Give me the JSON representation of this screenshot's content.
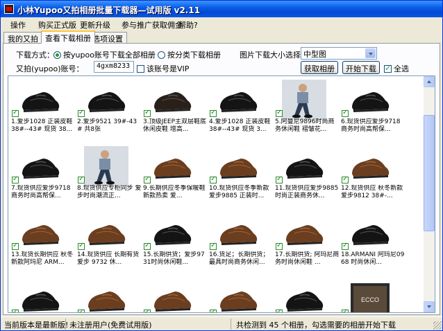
{
  "window": {
    "title": "小林Yupoo又拍相册批量下载器—试用版  v2.11"
  },
  "menu": [
    "操作",
    "购买正式版",
    "更新升级",
    "参与推广获取佣金",
    "帮助?"
  ],
  "tabs": [
    "我的又拍",
    "查看下载相册",
    "选项设置"
  ],
  "download_mode": {
    "label": "下载方式：",
    "option_all": "按yupoo账号下载全部相册",
    "option_category": "按分类下载相册"
  },
  "image_size": {
    "label": "图片下载大小选择：",
    "value": "中型图"
  },
  "account": {
    "label": "又拍(yupoo)账号：",
    "value": "4gxm8233",
    "vip_label": "该账号是VIP"
  },
  "buttons": {
    "fetch": "获取相册",
    "start": "开始下载",
    "select_all": "全选"
  },
  "albums": [
    {
      "caption": "1.爱步1028 正装皮鞋38#--43# 现货 38...",
      "thumb": "shoe-black"
    },
    {
      "caption": "2.爱步9521 39#-43# 共8张",
      "thumb": "shoe-black"
    },
    {
      "caption": "3.顶级JEEP主双层鞋底休闲皮鞋 增高...",
      "thumb": "shoe-dark"
    },
    {
      "caption": "4.爱步1028 正装皮鞋38#--43# 现货 3...",
      "thumb": "shoe-black"
    },
    {
      "caption": "5.阿曼尼9896时尚商务休闲鞋 褶皱花...",
      "thumb": "model"
    },
    {
      "caption": "6.现货供应爱步9718商务时尚高帮保...",
      "thumb": "shoe-black"
    },
    {
      "caption": "7.现货供应爱步9718商务时尚高帮保...",
      "thumb": "shoe-black"
    },
    {
      "caption": "8.现货供应专柜同步 爱步时尚潮流正...",
      "thumb": "model"
    },
    {
      "caption": "9.长期供应冬季保暖鞋新款热卖  爱...",
      "thumb": "shoe-brown"
    },
    {
      "caption": "10.现货供应冬季新款爱步9885 正装时...",
      "thumb": "shoe-brown"
    },
    {
      "caption": "11.现货供应爱步9885时尚正装商务休...",
      "thumb": "shoe-black"
    },
    {
      "caption": "12.现货供应 秋冬新款 爱步9812 38#-...",
      "thumb": "shoe-brown"
    },
    {
      "caption": "13.现货长期供应 秋冬新款阿玛尼 ARM...",
      "thumb": "shoe-brown"
    },
    {
      "caption": "14.现货供应 长期有货 爱步 9732 休...",
      "thumb": "shoe-brown"
    },
    {
      "caption": "15.长期供货；爱步9731时尚休闲鞋...",
      "thumb": "shoe-black"
    },
    {
      "caption": "16.货足；长期供货；最具时尚商务休闲...",
      "thumb": "shoe-brown"
    },
    {
      "caption": "17.长期供货; 阿玛尼商务时尚休闲鞋 ...",
      "thumb": "shoe-brown"
    },
    {
      "caption": "18.ARMANI  阿玛尼0968 时尚休闲...",
      "thumb": "shoe-black"
    },
    {
      "caption": "",
      "thumb": "shoe-black"
    },
    {
      "caption": "",
      "thumb": "shoe-brown"
    },
    {
      "caption": "",
      "thumb": "shoe-brown"
    },
    {
      "caption": "",
      "thumb": "shoe-brown"
    },
    {
      "caption": "",
      "thumb": "shoe-black"
    },
    {
      "caption": "",
      "thumb": "box"
    }
  ],
  "status": {
    "version": "当前版本是最新版!",
    "user": "未注册用户(免费试用版)",
    "count": "共检测到 45 个相册，勾选需要的相册开始下载"
  }
}
